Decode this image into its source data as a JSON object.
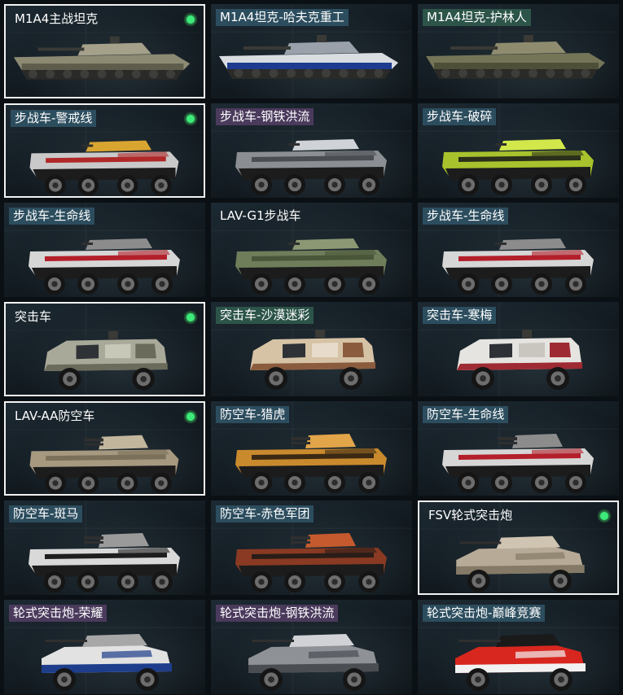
{
  "skins": [
    {
      "label": "M1A4主战坦克",
      "badge": "plain",
      "equipped": true,
      "kind": "tank",
      "hull": "#8d8a74",
      "accent": "#5e5c4a",
      "stripe": "#a4a08a"
    },
    {
      "label": "M1A4坦克-哈夫克重工",
      "badge": "blue",
      "equipped": false,
      "kind": "tank",
      "hull": "#d9dde2",
      "accent": "#1d3c8f",
      "stripe": "#9aa1ab"
    },
    {
      "label": "M1A4坦克-护林人",
      "badge": "green",
      "equipped": false,
      "kind": "tank",
      "hull": "#747558",
      "accent": "#4d4f38",
      "stripe": "#8e8b6f"
    },
    {
      "label": "步战车-警戒线",
      "badge": "blue",
      "equipped": true,
      "kind": "ifv",
      "hull": "#c9c9c9",
      "accent": "#b02828",
      "stripe": "#d9a531"
    },
    {
      "label": "步战车-钢铁洪流",
      "badge": "purple",
      "equipped": false,
      "kind": "ifv",
      "hull": "#8b8e92",
      "accent": "#4a4d52",
      "stripe": "#cfd2d6"
    },
    {
      "label": "步战车-破碎",
      "badge": "blue",
      "equipped": false,
      "kind": "ifv",
      "hull": "#a7c22c",
      "accent": "#2a2e1a",
      "stripe": "#d2e84a"
    },
    {
      "label": "步战车-生命线",
      "badge": "blue",
      "equipped": false,
      "kind": "ifv",
      "hull": "#d6d6d6",
      "accent": "#b31f2a",
      "stripe": "#8c8c8c"
    },
    {
      "label": "LAV-G1步战车",
      "badge": "plain",
      "equipped": false,
      "kind": "ifv",
      "hull": "#6f7d5a",
      "accent": "#4a5639",
      "stripe": "#8c9873"
    },
    {
      "label": "步战车-生命线",
      "badge": "blue",
      "equipped": false,
      "kind": "ifv",
      "hull": "#d6d6d6",
      "accent": "#b31f2a",
      "stripe": "#8c8c8c"
    },
    {
      "label": "突击车",
      "badge": "plain",
      "equipped": true,
      "kind": "mrap",
      "hull": "#a9a99a",
      "accent": "#6b6b5c",
      "stripe": "#c8c8b8"
    },
    {
      "label": "突击车-沙漠迷彩",
      "badge": "green",
      "equipped": false,
      "kind": "mrap",
      "hull": "#d6c3a6",
      "accent": "#8a5c3d",
      "stripe": "#e7dccb"
    },
    {
      "label": "突击车-寒梅",
      "badge": "blue",
      "equipped": false,
      "kind": "mrap",
      "hull": "#e6e4e0",
      "accent": "#9e2a33",
      "stripe": "#c9c6c0"
    },
    {
      "label": "LAV-AA防空车",
      "badge": "plain",
      "equipped": true,
      "kind": "aa",
      "hull": "#a69980",
      "accent": "#7b705a",
      "stripe": "#c2b79d"
    },
    {
      "label": "防空车-猎虎",
      "badge": "blue",
      "equipped": false,
      "kind": "aa",
      "hull": "#c98a2e",
      "accent": "#3b2914",
      "stripe": "#e2a54a"
    },
    {
      "label": "防空车-生命线",
      "badge": "blue",
      "equipped": false,
      "kind": "aa",
      "hull": "#d6d6d6",
      "accent": "#b31f2a",
      "stripe": "#8c8c8c"
    },
    {
      "label": "防空车-斑马",
      "badge": "blue",
      "equipped": false,
      "kind": "aa",
      "hull": "#d9d9d9",
      "accent": "#1e1e1e",
      "stripe": "#9a9a9a"
    },
    {
      "label": "防空车-赤色军团",
      "badge": "blue",
      "equipped": false,
      "kind": "aa",
      "hull": "#8a3a22",
      "accent": "#2a1d18",
      "stripe": "#c45a2e"
    },
    {
      "label": "FSV轮式突击炮",
      "badge": "plain",
      "equipped": true,
      "kind": "fsv",
      "hull": "#b7ab98",
      "accent": "#857a67",
      "stripe": "#cfc4b1"
    },
    {
      "label": "轮式突击炮-荣耀",
      "badge": "purple",
      "equipped": false,
      "kind": "fsv",
      "hull": "#e2e2e2",
      "accent": "#1e3e8c",
      "stripe": "#a7a7a7"
    },
    {
      "label": "轮式突击炮-钢铁洪流",
      "badge": "purple",
      "equipped": false,
      "kind": "fsv",
      "hull": "#8e9196",
      "accent": "#4a4d52",
      "stripe": "#d0d2d6"
    },
    {
      "label": "轮式突击炮-巅峰竞赛",
      "badge": "blue",
      "equipped": false,
      "kind": "fsv",
      "hull": "#d8271f",
      "accent": "#f2f2f2",
      "stripe": "#1a1a1a"
    }
  ],
  "colors": {
    "equipped_border": "#f2f2f2",
    "equipped_dot": "#3dea7a",
    "badge_blue": "#2c4d5e",
    "badge_purple": "#4a3a5c",
    "badge_green": "#2c5448"
  }
}
